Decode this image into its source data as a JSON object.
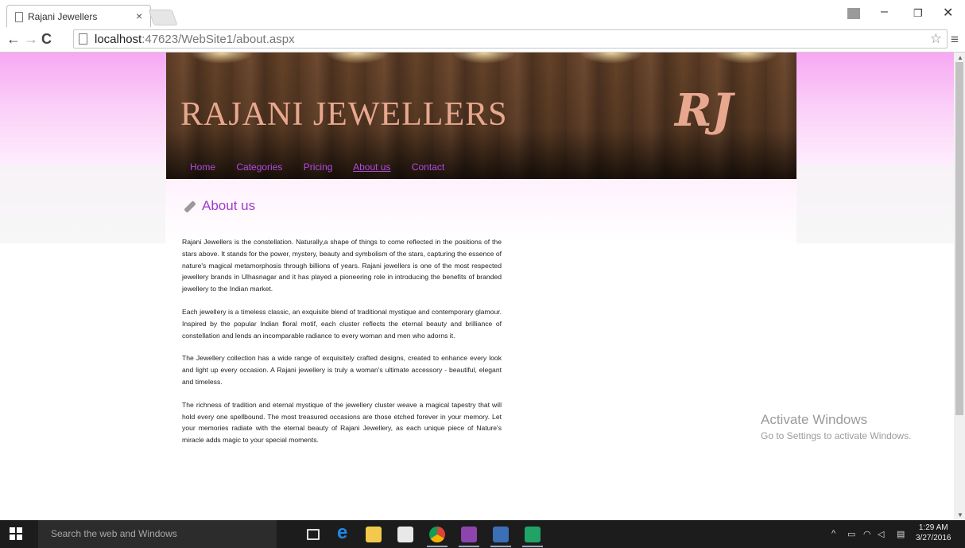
{
  "browser": {
    "tab_title": "Rajani Jewellers",
    "tab_close": "×",
    "url_host": "localhost",
    "url_rest": ":47623/WebSite1/about.aspx"
  },
  "site": {
    "title": "RAJANI JEWELLERS",
    "logo_text": "RJ",
    "menu": [
      "Home",
      "Categories",
      "Pricing",
      "About us",
      "Contact"
    ],
    "active_menu": "About us"
  },
  "page": {
    "heading": "About us",
    "paragraphs": [
      "Rajani Jewellers is the constellation. Naturally,a shape of things to come reflected in the positions of the stars above. It stands for the power, mystery, beauty and symbolism of the stars, capturing the essence of nature's magical metamorphosis through billions of years. Rajani jewellers is one of the most respected jewellery brands in Ulhasnagar and it has played a pioneering role in introducing the benefits of branded jewellery to the Indian market.",
      "Each jewellery is a timeless classic, an exquisite blend of traditional mystique and contemporary glamour. Inspired by the popular Indian floral motif, each cluster reflects the eternal beauty and brilliance of constellation and lends an incomparable radiance to every woman and men who adorns it.",
      "The Jewellery collection has a wide range of exquisitely crafted designs, created to enhance every look and light up every occasion. A Rajani jewellery is truly a woman's ultimate accessory - beautiful, elegant and timeless.",
      "The richness of tradition and eternal mystique of the jewellery cluster weave a magical tapestry that will hold every one spellbound. The most treasured occasions are those etched forever in your memory. Let your memories radiate with the eternal beauty of Rajani Jewellery, as each unique piece of Nature's miracle adds magic to your special moments."
    ]
  },
  "watermark": {
    "line1": "Activate Windows",
    "line2": "Go to Settings to activate Windows."
  },
  "taskbar": {
    "search_placeholder": "Search the web and Windows",
    "time": "1:29 AM",
    "date": "3/27/2016"
  },
  "colors": {
    "accent_purple": "#b44ae0",
    "title_gold": "#e8a88f",
    "header_wood": "#5a3a24"
  }
}
